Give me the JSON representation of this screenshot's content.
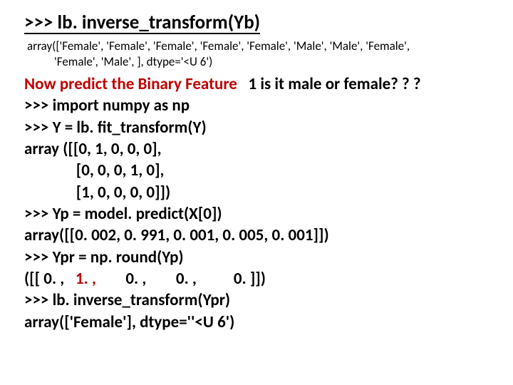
{
  "title": ">>> lb. inverse_transform(Yb)",
  "array_line1": "array(['Female', 'Female', 'Female', 'Female', 'Female', 'Male', 'Male', 'Female',",
  "array_line2": "'Female', 'Male', ], dtype='<U 6')",
  "l1_a": "Now predict the Binary Feature   ",
  "l1_b": "1 is it male or female? ? ?",
  "l2": ">>> import numpy as np",
  "l3": ">>> Y = lb. fit_transform(Y)",
  "l4": "array ([[0, 1, 0, 0, 0],",
  "l5": "              [0, 0, 0, 1, 0],",
  "l6": "              [1, 0, 0, 0, 0]])",
  "l7": ">>> Yp = model. predict(X[0])",
  "l8": "array([[0. 002, 0. 991, 0. 001, 0. 005, 0. 001]])",
  "l9": ">>> Ypr = np. round(Yp)",
  "l10_a": "([[ 0. ,   ",
  "l10_b": "1. ,",
  "l10_c": "        0. ,        0. ,          0. ]])",
  "l11": ">>> lb. inverse_transform(Ypr)",
  "l12": "array(['Female'], dtype=''<U 6')"
}
